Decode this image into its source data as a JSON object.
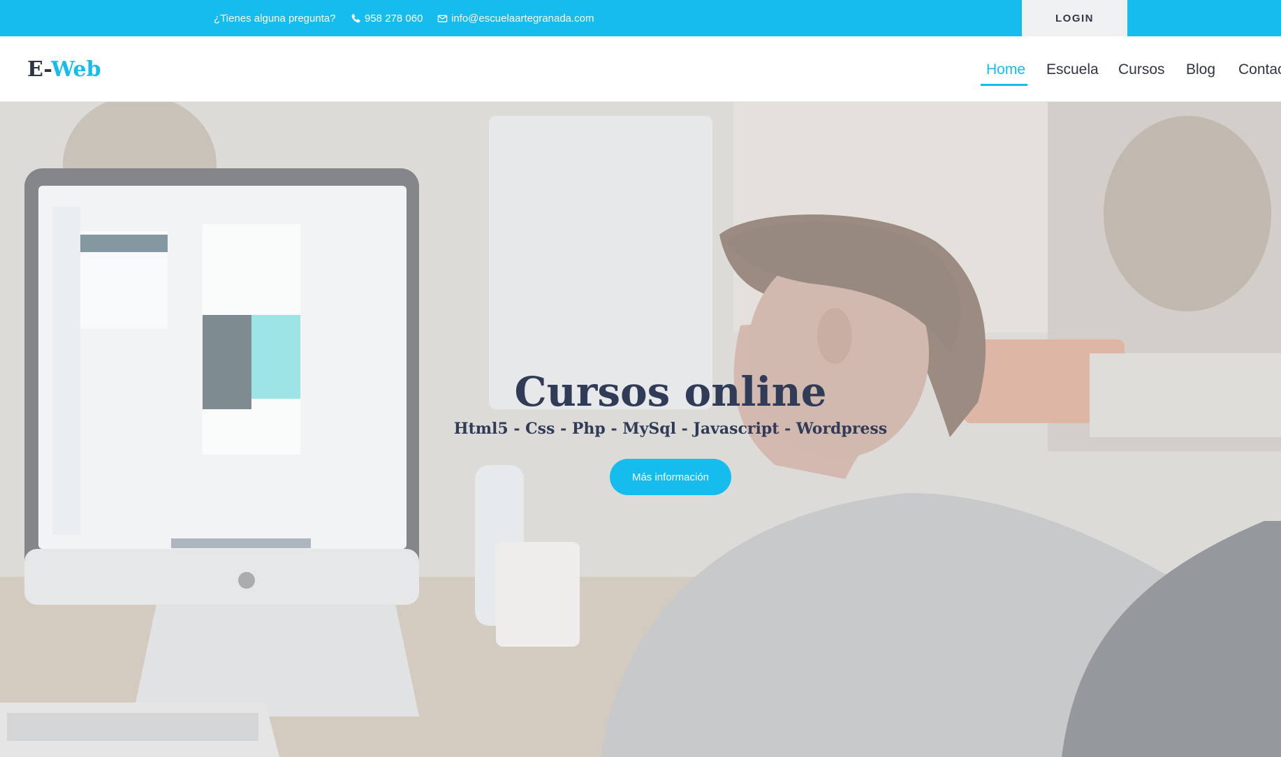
{
  "topbar": {
    "question": "¿Tienes alguna pregunta?",
    "phone": "958 278 060",
    "email": "info@escuelaartegranada.com",
    "login_label": "LOGIN",
    "icons": {
      "phone": "phone-icon",
      "email": "envelope-icon"
    }
  },
  "navbar": {
    "logo_part_a": "E-",
    "logo_part_b": "Web",
    "links": [
      {
        "label": "Home",
        "active": true
      },
      {
        "label": "Escuela",
        "active": false
      },
      {
        "label": "Cursos",
        "active": false
      },
      {
        "label": "Blog",
        "active": false
      },
      {
        "label": "Contac",
        "active": false
      }
    ]
  },
  "hero": {
    "title": "Cursos online",
    "subtitle": "Html5 - Css - Php - MySql - Javascript - Wordpress",
    "cta_label": "Más información",
    "background_image": "person-working-at-computer-photo"
  },
  "colors": {
    "accent": "#15bdee",
    "text_dark": "#2f3542",
    "login_bg": "#eef0f2"
  }
}
